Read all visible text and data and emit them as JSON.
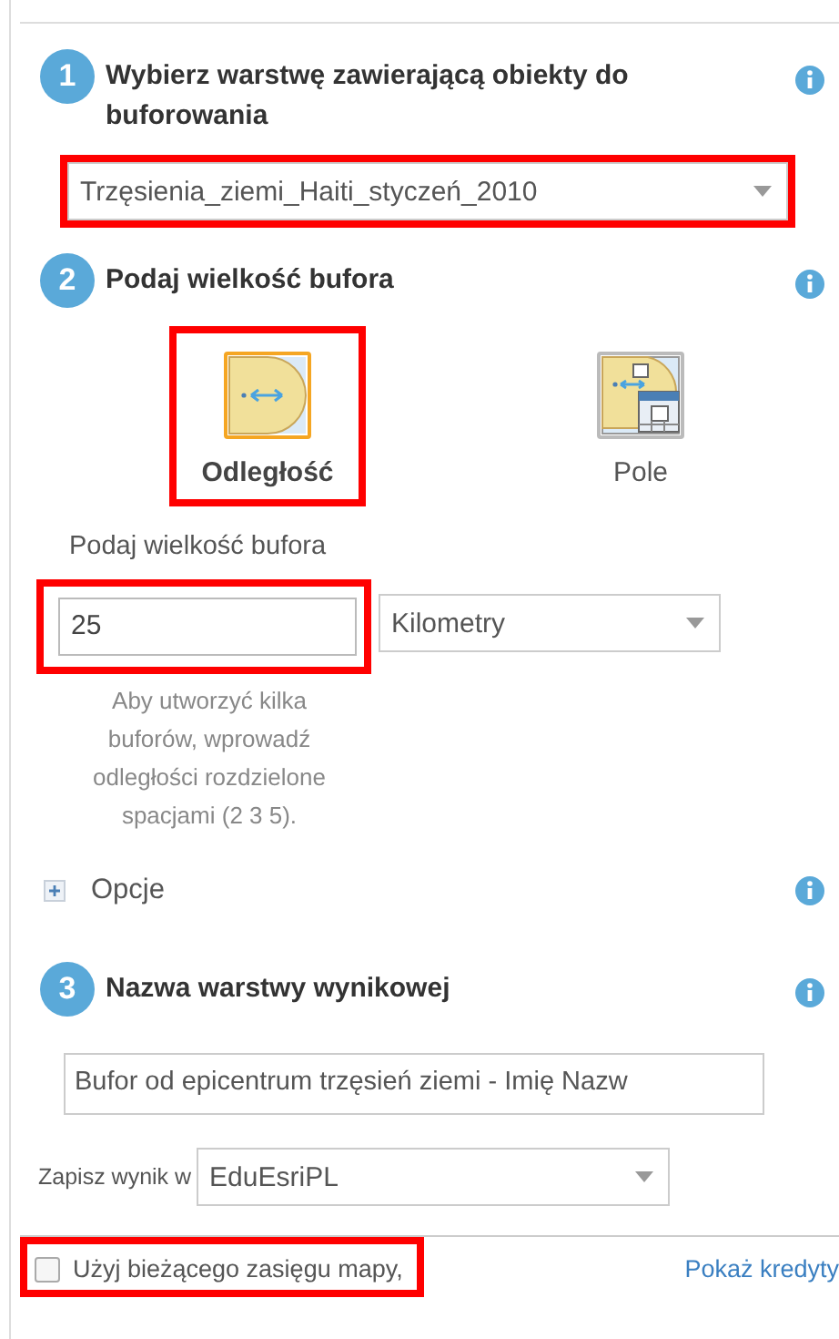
{
  "step1": {
    "number": "1",
    "title": "Wybierz warstwę zawierającą obiekty do buforowania",
    "layer_select": {
      "value": "Trzęsienia_ziemi_Haiti_styczeń_2010",
      "highlighted": true
    }
  },
  "step2": {
    "number": "2",
    "title": "Podaj wielkość bufora",
    "options": [
      {
        "label": "Odległość",
        "kind": "distance",
        "selected": true,
        "highlighted": true
      },
      {
        "label": "Pole",
        "kind": "field",
        "selected": false,
        "highlighted": false
      }
    ],
    "size_label": "Podaj wielkość bufora",
    "size_input": {
      "value": "25",
      "highlighted": true
    },
    "unit_select": {
      "value": "Kilometry"
    },
    "hint": "Aby utworzyć kilka buforów, wprowadź odległości rozdzielone spacjami (2 3 5)."
  },
  "options_section": {
    "label": "Opcje",
    "expanded": false
  },
  "step3": {
    "number": "3",
    "title": "Nazwa warstwy wynikowej",
    "name_input": {
      "value": "Bufor od epicentrum trzęsień ziemi - Imię Nazw"
    },
    "save_label": "Zapisz wynik w",
    "save_select": {
      "value": "EduEsriPL"
    }
  },
  "footer": {
    "extent_checkbox": {
      "label": "Użyj bieżącego zasięgu mapy,",
      "checked": false,
      "highlighted": true
    },
    "credits_link": "Pokaż kredyty"
  }
}
